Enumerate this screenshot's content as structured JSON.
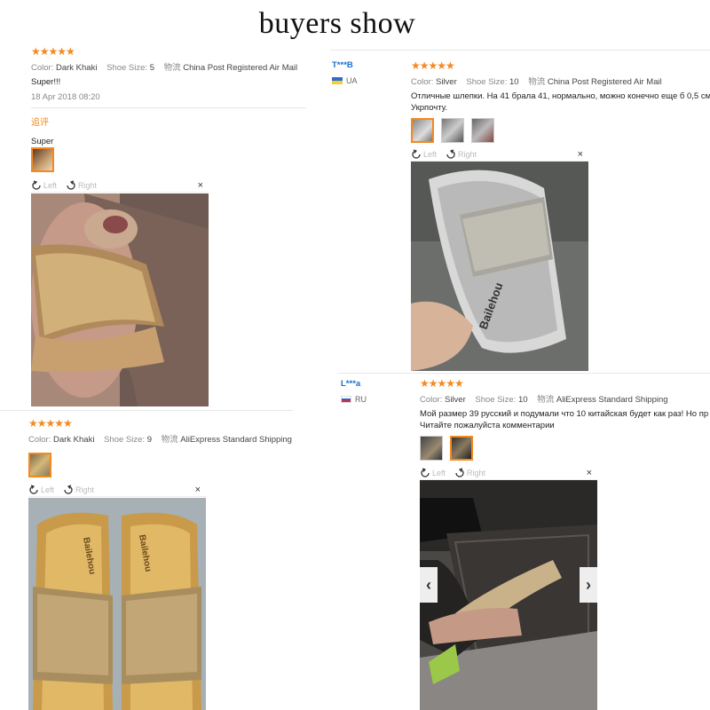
{
  "page_title": "buyers show",
  "labels": {
    "color": "Color:",
    "shoe_size": "Shoe Size:",
    "logistics": "物流",
    "left": "Left",
    "right": "Right",
    "close": "×"
  },
  "reviews": [
    {
      "stars": "★★★★★",
      "color": "Dark Khaki",
      "size": "5",
      "shipping": "China Post Registered Air Mail",
      "text": "Super!!!",
      "date": "18 Apr 2018 08:20",
      "followup_label": "追评",
      "followup_text": "Super"
    },
    {
      "user": "T***B",
      "country": "UA",
      "stars": "★★★★★",
      "color": "Silver",
      "size": "10",
      "shipping": "China Post Registered Air Mail",
      "text": "Отличные шлепки. На 41 брала 41, нормально, можно конечно еще б 0,5 см",
      "text2": "Укрпочту."
    },
    {
      "stars": "★★★★★",
      "color": "Dark Khaki",
      "size": "9",
      "shipping": "AliExpress Standard Shipping"
    },
    {
      "user": "L***a",
      "country": "RU",
      "stars": "★★★★★",
      "color": "Silver",
      "size": "10",
      "shipping": "AliExpress Standard Shipping",
      "text": "Мой размер 39 русский и подумали что 10 китайская будет как раз! Но пр",
      "text2": "Читайте пожалуйста комментарии"
    }
  ],
  "colors": {
    "accent": "#f5891f",
    "user": "#1a6ec8"
  }
}
